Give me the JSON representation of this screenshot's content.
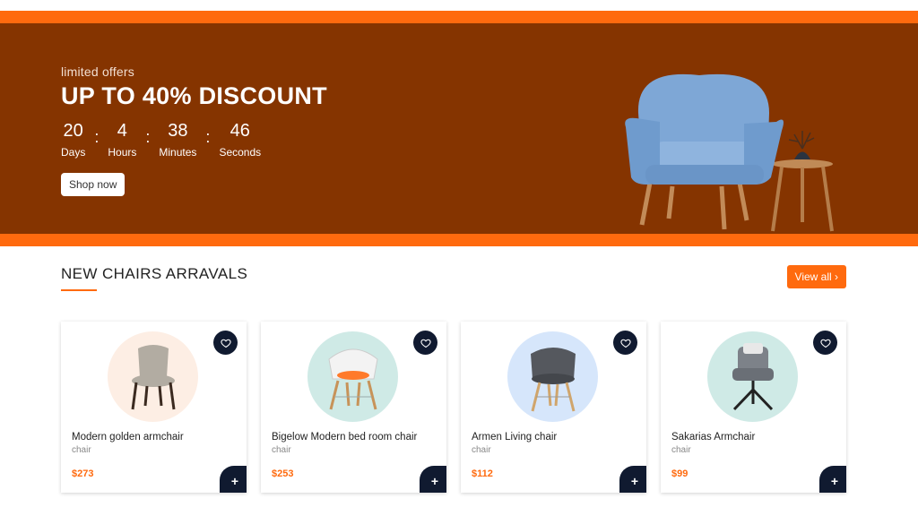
{
  "hero": {
    "kicker": "limited offers",
    "title": "UP TO 40% DISCOUNT",
    "countdown": [
      {
        "value": "20",
        "label": "Days"
      },
      {
        "value": "4",
        "label": "Hours"
      },
      {
        "value": "38",
        "label": "Minutes"
      },
      {
        "value": "46",
        "label": "Seconds"
      }
    ],
    "separator": ":",
    "cta_label": "Shop now"
  },
  "section": {
    "title": "NEW CHAIRS ARRAVALS",
    "view_all_label": "View all ›"
  },
  "products": [
    {
      "name": "Modern golden armchair",
      "category": "chair",
      "price": "$273",
      "bg": "#fdeee4",
      "seat": "#b2aca2"
    },
    {
      "name": "Bigelow Modern bed room chair",
      "category": "chair",
      "price": "$253",
      "bg": "#cfeae6",
      "seat": "#f3f3f3"
    },
    {
      "name": "Armen Living chair",
      "category": "chair",
      "price": "$112",
      "bg": "#d6e6fb",
      "seat": "#55585e"
    },
    {
      "name": "Sakarias Armchair",
      "category": "chair",
      "price": "$99",
      "bg": "#cfeae6",
      "seat": "#7d8289"
    }
  ],
  "add_label": "+",
  "colors": {
    "brand": "#ff6a0e",
    "hero_bg": "#853400",
    "dark": "#101a30"
  }
}
